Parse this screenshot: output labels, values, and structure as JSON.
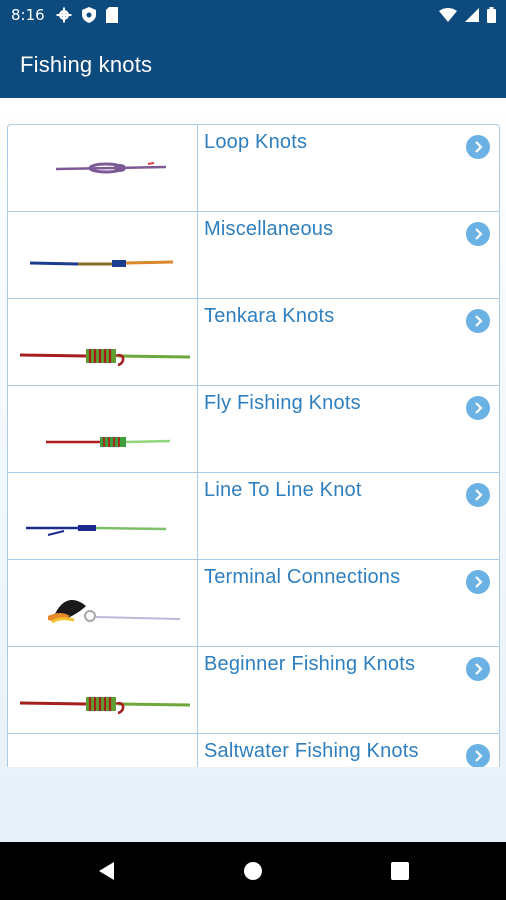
{
  "status": {
    "time": "8:16"
  },
  "appbar": {
    "title": "Fishing knots"
  },
  "categories": [
    {
      "label": "Loop Knots",
      "thumb": "loop-knot"
    },
    {
      "label": "Miscellaneous",
      "thumb": "misc-knot"
    },
    {
      "label": "Tenkara Knots",
      "thumb": "tenkara-knot"
    },
    {
      "label": "Fly Fishing Knots",
      "thumb": "fly-knot"
    },
    {
      "label": "Line To Line Knot",
      "thumb": "line-knot"
    },
    {
      "label": "Terminal Connections",
      "thumb": "fly-lure"
    },
    {
      "label": "Beginner Fishing Knots",
      "thumb": "beginner-knot"
    },
    {
      "label": "Saltwater Fishing Knots",
      "thumb": "saltwater-knot"
    }
  ],
  "colors": {
    "appbar": "#0d4a7d",
    "link": "#2f7fbf",
    "chevron": "#6bb2e4",
    "border": "#a9cbe6"
  }
}
